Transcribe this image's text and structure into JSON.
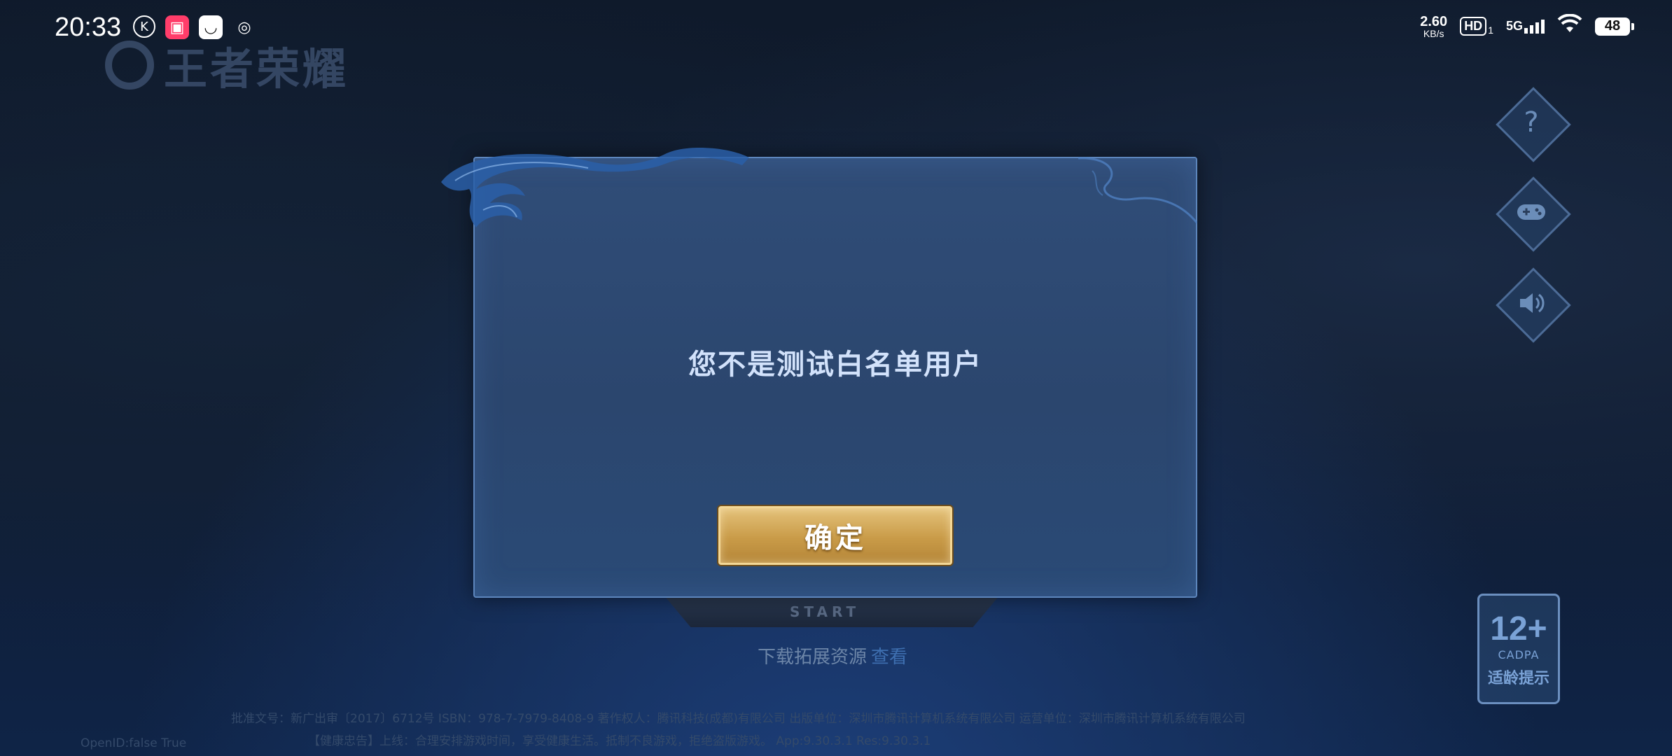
{
  "status_bar": {
    "time": "20:33",
    "net_speed_value": "2.60",
    "net_speed_unit": "KB/s",
    "hd_label": "HD",
    "hd_sub": "1",
    "network_type": "5G",
    "battery": "48"
  },
  "background": {
    "game_logo": "王者荣耀",
    "start_text": "START",
    "download_label": "下载拓展资源",
    "download_link": "查看",
    "age_badge": {
      "rating": "12+",
      "org": "CADPA",
      "tip": "适龄提示"
    },
    "footer_line_1": "批准文号：新广出审〔2017〕6712号  ISBN：978-7-7979-8408-9  著作权人：腾讯科技(成都)有限公司  出版单位：深圳市腾讯计算机系统有限公司  运营单位：深圳市腾讯计算机系统有限公司",
    "footer_line_2": "【健康忠告】上线：合理安排游戏时间，享受健康生活。抵制不良游戏，拒绝盗版游戏。 App:9.30.3.1  Res:9.30.3.1",
    "openid_text": "OpenID:false True"
  },
  "dialog": {
    "message": "您不是测试白名单用户",
    "confirm_label": "确定"
  },
  "colors": {
    "dialog_bg": "#304d78",
    "dialog_border": "#5d86bd",
    "button_gold": "#c99b48"
  }
}
